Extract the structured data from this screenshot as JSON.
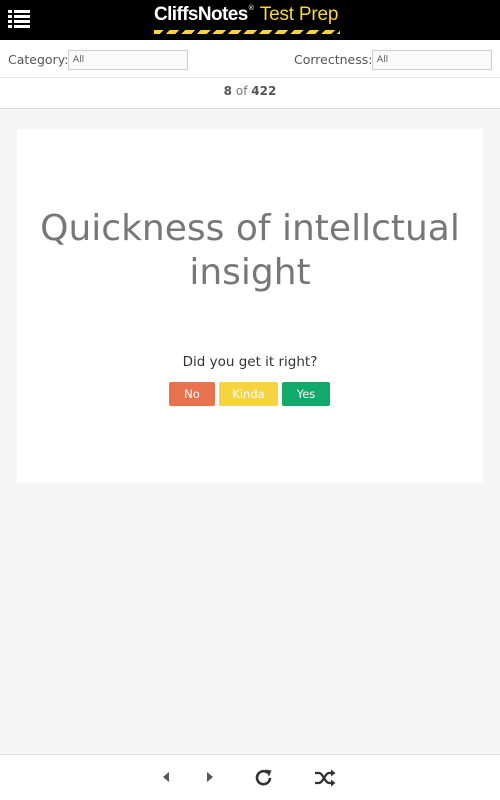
{
  "header": {
    "brand": "CliffsNotes",
    "reg": "®",
    "product": "Test Prep"
  },
  "filters": {
    "category_label": "Category:",
    "category_value": "All",
    "correctness_label": "Correctness:",
    "correctness_value": "All"
  },
  "counter": {
    "current": "8",
    "of": "of",
    "total": "422"
  },
  "card": {
    "term": "Quickness of intellctual insight",
    "prompt": "Did you get it right?",
    "no_label": "No",
    "kinda_label": "Kinda",
    "yes_label": "Yes"
  },
  "colors": {
    "no": "#e8714f",
    "kinda": "#f5d43f",
    "yes": "#12aa6b",
    "brand_accent": "#f7d63d"
  },
  "icons": {
    "menu": "menu-list-icon",
    "previous": "triangle-left-icon",
    "next": "triangle-right-icon",
    "restart": "refresh-icon",
    "shuffle": "shuffle-icon"
  }
}
